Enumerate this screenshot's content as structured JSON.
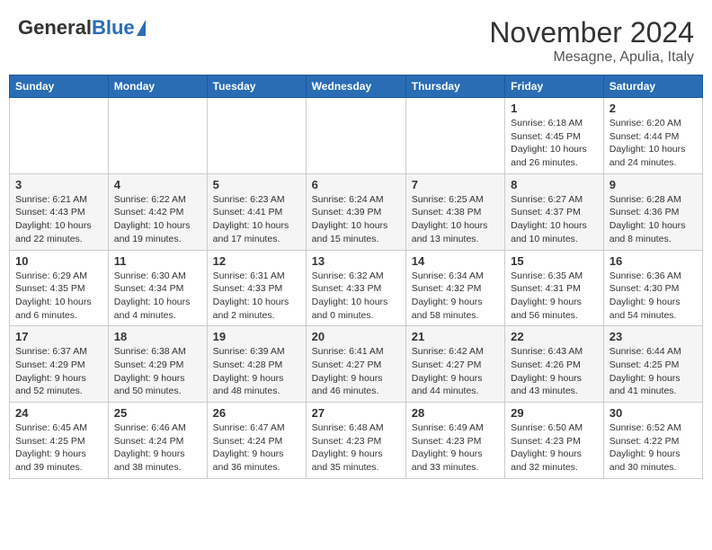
{
  "header": {
    "logo_general": "General",
    "logo_blue": "Blue",
    "month_title": "November 2024",
    "location": "Mesagne, Apulia, Italy"
  },
  "days_of_week": [
    "Sunday",
    "Monday",
    "Tuesday",
    "Wednesday",
    "Thursday",
    "Friday",
    "Saturday"
  ],
  "weeks": [
    [
      {
        "day": "",
        "info": ""
      },
      {
        "day": "",
        "info": ""
      },
      {
        "day": "",
        "info": ""
      },
      {
        "day": "",
        "info": ""
      },
      {
        "day": "",
        "info": ""
      },
      {
        "day": "1",
        "info": "Sunrise: 6:18 AM\nSunset: 4:45 PM\nDaylight: 10 hours\nand 26 minutes."
      },
      {
        "day": "2",
        "info": "Sunrise: 6:20 AM\nSunset: 4:44 PM\nDaylight: 10 hours\nand 24 minutes."
      }
    ],
    [
      {
        "day": "3",
        "info": "Sunrise: 6:21 AM\nSunset: 4:43 PM\nDaylight: 10 hours\nand 22 minutes."
      },
      {
        "day": "4",
        "info": "Sunrise: 6:22 AM\nSunset: 4:42 PM\nDaylight: 10 hours\nand 19 minutes."
      },
      {
        "day": "5",
        "info": "Sunrise: 6:23 AM\nSunset: 4:41 PM\nDaylight: 10 hours\nand 17 minutes."
      },
      {
        "day": "6",
        "info": "Sunrise: 6:24 AM\nSunset: 4:39 PM\nDaylight: 10 hours\nand 15 minutes."
      },
      {
        "day": "7",
        "info": "Sunrise: 6:25 AM\nSunset: 4:38 PM\nDaylight: 10 hours\nand 13 minutes."
      },
      {
        "day": "8",
        "info": "Sunrise: 6:27 AM\nSunset: 4:37 PM\nDaylight: 10 hours\nand 10 minutes."
      },
      {
        "day": "9",
        "info": "Sunrise: 6:28 AM\nSunset: 4:36 PM\nDaylight: 10 hours\nand 8 minutes."
      }
    ],
    [
      {
        "day": "10",
        "info": "Sunrise: 6:29 AM\nSunset: 4:35 PM\nDaylight: 10 hours\nand 6 minutes."
      },
      {
        "day": "11",
        "info": "Sunrise: 6:30 AM\nSunset: 4:34 PM\nDaylight: 10 hours\nand 4 minutes."
      },
      {
        "day": "12",
        "info": "Sunrise: 6:31 AM\nSunset: 4:33 PM\nDaylight: 10 hours\nand 2 minutes."
      },
      {
        "day": "13",
        "info": "Sunrise: 6:32 AM\nSunset: 4:33 PM\nDaylight: 10 hours\nand 0 minutes."
      },
      {
        "day": "14",
        "info": "Sunrise: 6:34 AM\nSunset: 4:32 PM\nDaylight: 9 hours\nand 58 minutes."
      },
      {
        "day": "15",
        "info": "Sunrise: 6:35 AM\nSunset: 4:31 PM\nDaylight: 9 hours\nand 56 minutes."
      },
      {
        "day": "16",
        "info": "Sunrise: 6:36 AM\nSunset: 4:30 PM\nDaylight: 9 hours\nand 54 minutes."
      }
    ],
    [
      {
        "day": "17",
        "info": "Sunrise: 6:37 AM\nSunset: 4:29 PM\nDaylight: 9 hours\nand 52 minutes."
      },
      {
        "day": "18",
        "info": "Sunrise: 6:38 AM\nSunset: 4:29 PM\nDaylight: 9 hours\nand 50 minutes."
      },
      {
        "day": "19",
        "info": "Sunrise: 6:39 AM\nSunset: 4:28 PM\nDaylight: 9 hours\nand 48 minutes."
      },
      {
        "day": "20",
        "info": "Sunrise: 6:41 AM\nSunset: 4:27 PM\nDaylight: 9 hours\nand 46 minutes."
      },
      {
        "day": "21",
        "info": "Sunrise: 6:42 AM\nSunset: 4:27 PM\nDaylight: 9 hours\nand 44 minutes."
      },
      {
        "day": "22",
        "info": "Sunrise: 6:43 AM\nSunset: 4:26 PM\nDaylight: 9 hours\nand 43 minutes."
      },
      {
        "day": "23",
        "info": "Sunrise: 6:44 AM\nSunset: 4:25 PM\nDaylight: 9 hours\nand 41 minutes."
      }
    ],
    [
      {
        "day": "24",
        "info": "Sunrise: 6:45 AM\nSunset: 4:25 PM\nDaylight: 9 hours\nand 39 minutes."
      },
      {
        "day": "25",
        "info": "Sunrise: 6:46 AM\nSunset: 4:24 PM\nDaylight: 9 hours\nand 38 minutes."
      },
      {
        "day": "26",
        "info": "Sunrise: 6:47 AM\nSunset: 4:24 PM\nDaylight: 9 hours\nand 36 minutes."
      },
      {
        "day": "27",
        "info": "Sunrise: 6:48 AM\nSunset: 4:23 PM\nDaylight: 9 hours\nand 35 minutes."
      },
      {
        "day": "28",
        "info": "Sunrise: 6:49 AM\nSunset: 4:23 PM\nDaylight: 9 hours\nand 33 minutes."
      },
      {
        "day": "29",
        "info": "Sunrise: 6:50 AM\nSunset: 4:23 PM\nDaylight: 9 hours\nand 32 minutes."
      },
      {
        "day": "30",
        "info": "Sunrise: 6:52 AM\nSunset: 4:22 PM\nDaylight: 9 hours\nand 30 minutes."
      }
    ]
  ]
}
